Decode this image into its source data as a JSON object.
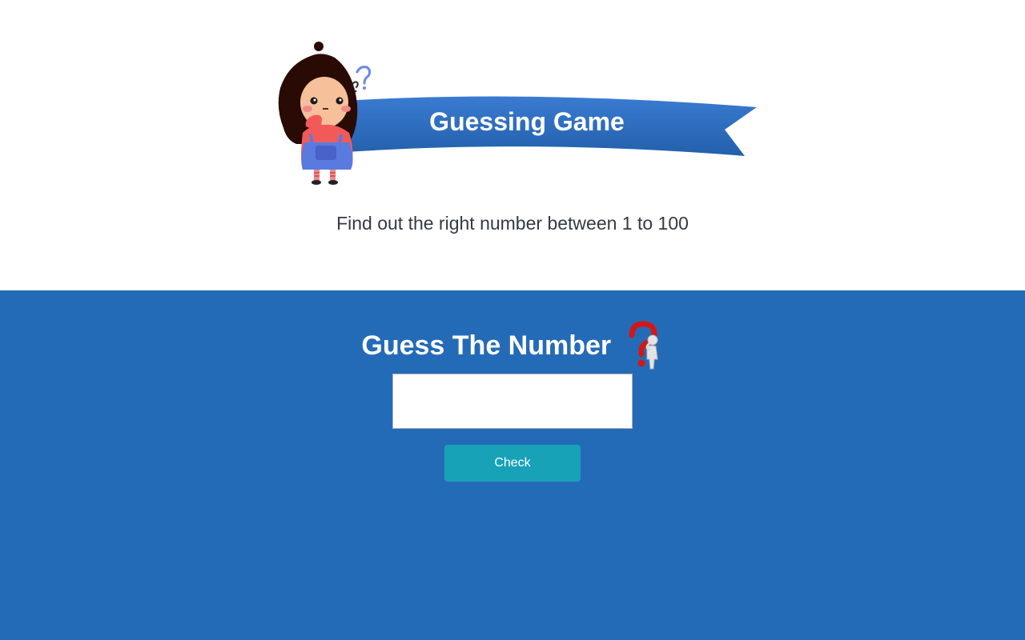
{
  "header": {
    "banner_title": "Guessing Game",
    "subtitle": "Find out the right number between 1 to 100"
  },
  "game": {
    "section_title": "Guess The Number",
    "input_value": "",
    "input_placeholder": "",
    "check_label": "Check"
  },
  "icons": {
    "hero": "thinking-girl-icon",
    "title": "question-mark-figure-icon"
  },
  "colors": {
    "banner_blue": "#2f6fc4",
    "section_blue": "#246bb7",
    "button_teal": "#17a2b8",
    "text_dark": "#333a44"
  }
}
